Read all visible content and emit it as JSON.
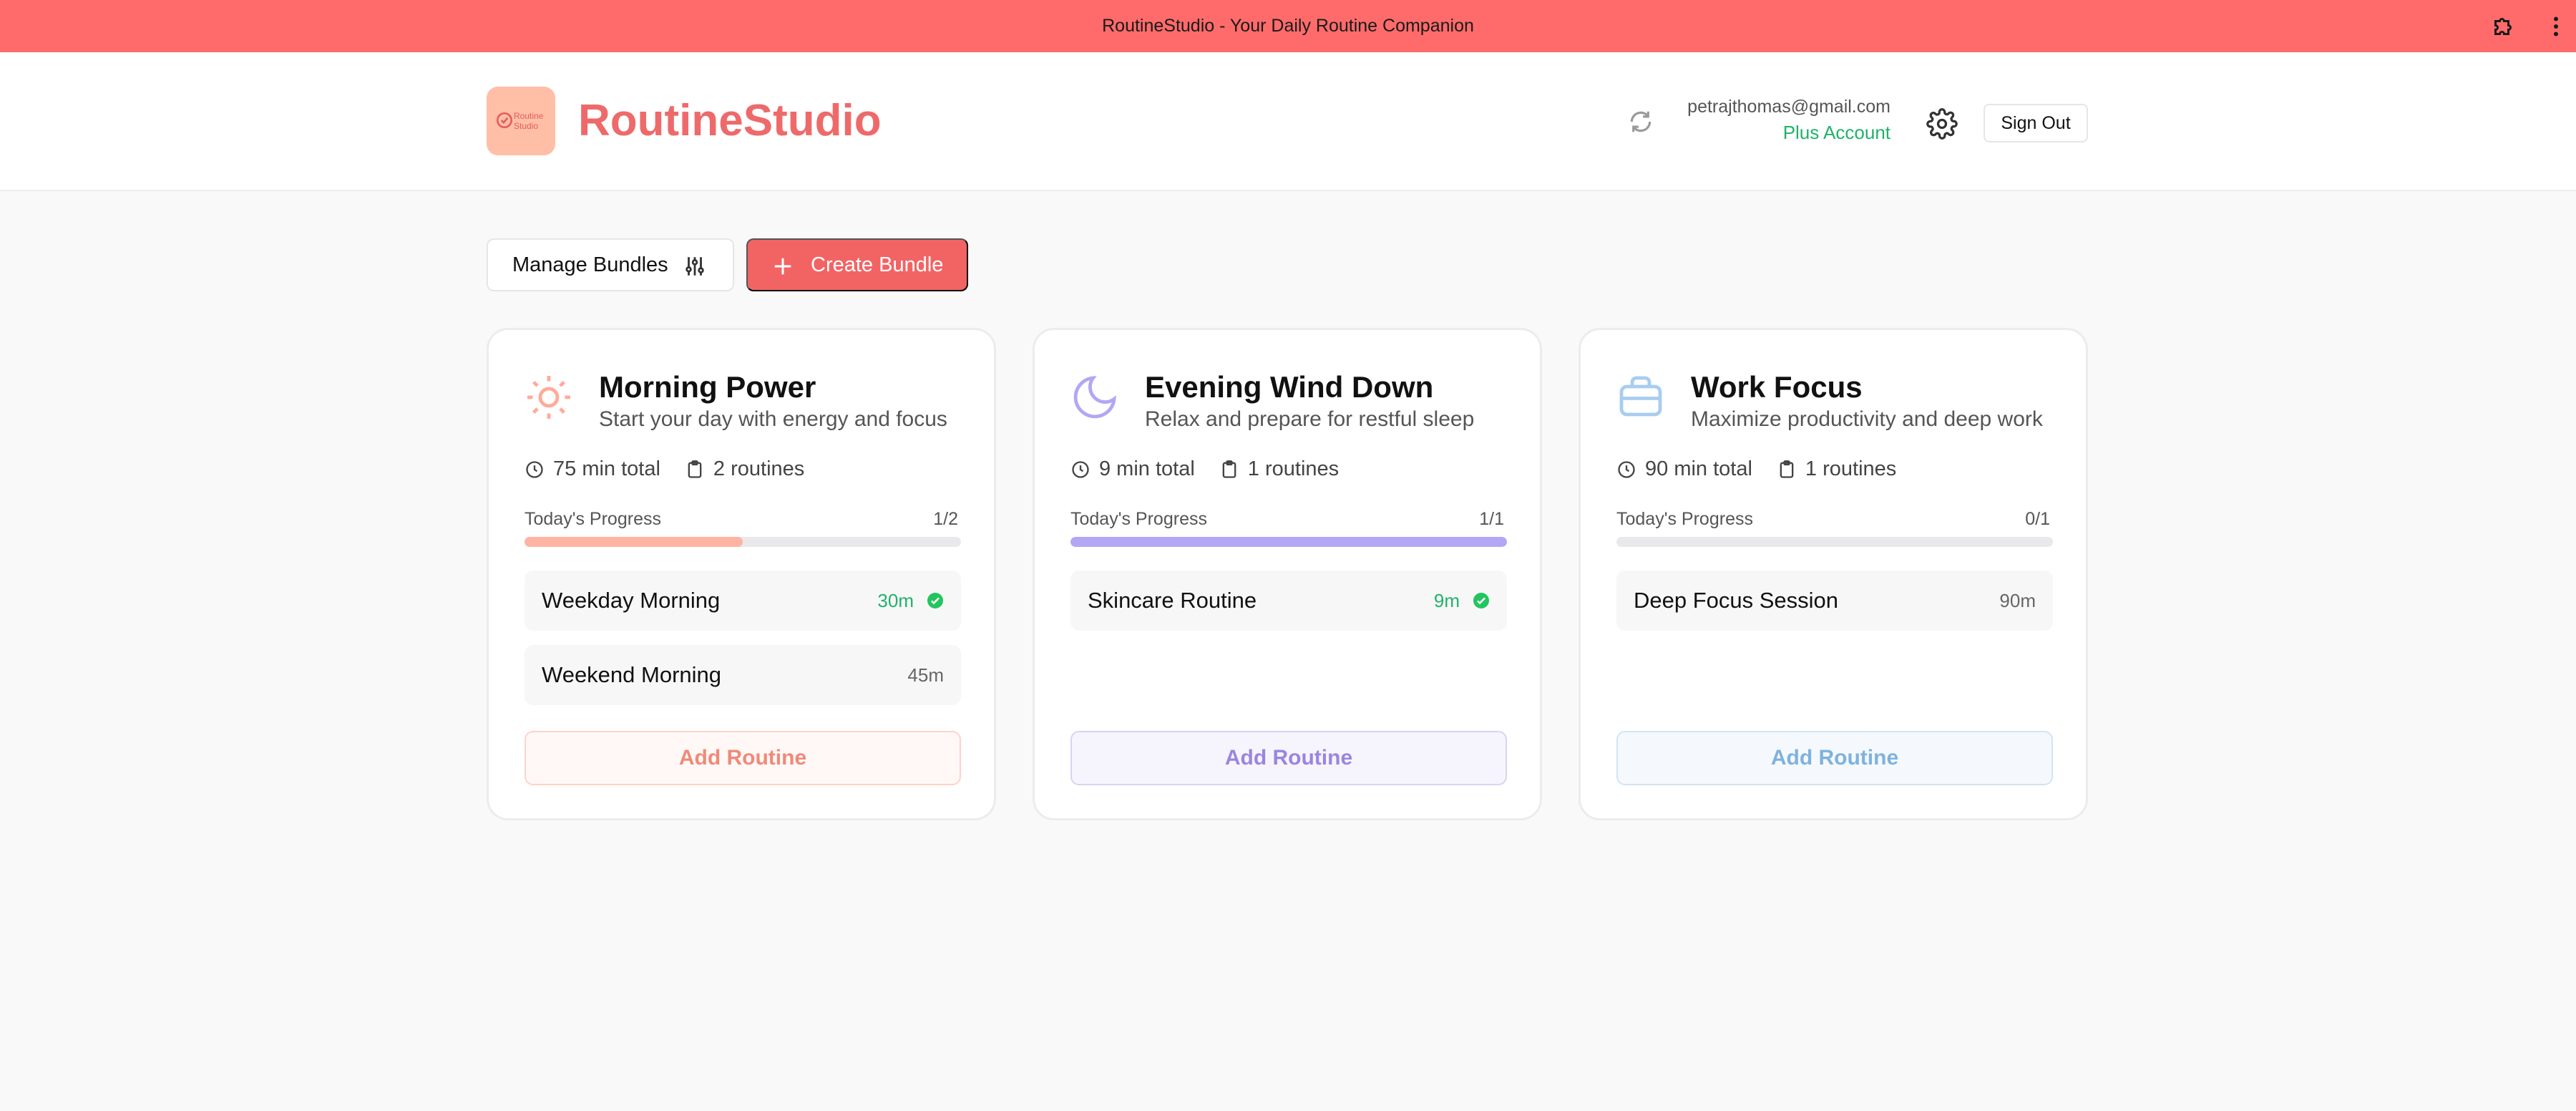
{
  "window": {
    "title": "RoutineStudio - Your Daily Routine Companion"
  },
  "brand": {
    "name": "RoutineStudio",
    "logo_text": "Routine Studio",
    "accent": "#ee6a6a"
  },
  "account": {
    "email": "petrajthomas@gmail.com",
    "plan": "Plus Account",
    "sign_out_label": "Sign Out"
  },
  "toolbar": {
    "manage_label": "Manage Bundles",
    "create_label": "Create Bundle"
  },
  "bundles": [
    {
      "title": "Morning Power",
      "subtitle": "Start your day with energy and focus",
      "total": "75 min total",
      "routines_count": "2 routines",
      "progress_label": "Today's Progress",
      "progress_count": "1/2",
      "progress_fraction": 0.5,
      "color": "#ffb3a3",
      "icon": "sun-icon",
      "routines": [
        {
          "name": "Weekday Morning",
          "duration": "30m",
          "done": true
        },
        {
          "name": "Weekend Morning",
          "duration": "45m",
          "done": false
        }
      ],
      "add_label": "Add Routine"
    },
    {
      "title": "Evening Wind Down",
      "subtitle": "Relax and prepare for restful sleep",
      "total": "9 min total",
      "routines_count": "1 routines",
      "progress_label": "Today's Progress",
      "progress_count": "1/1",
      "progress_fraction": 1.0,
      "color": "#b3a6f5",
      "icon": "moon-icon",
      "routines": [
        {
          "name": "Skincare Routine",
          "duration": "9m",
          "done": true
        }
      ],
      "add_label": "Add Routine"
    },
    {
      "title": "Work Focus",
      "subtitle": "Maximize productivity and deep work",
      "total": "90 min total",
      "routines_count": "1 routines",
      "progress_label": "Today's Progress",
      "progress_count": "0/1",
      "progress_fraction": 0.0,
      "color": "#a8cdf0",
      "icon": "briefcase-icon",
      "routines": [
        {
          "name": "Deep Focus Session",
          "duration": "90m",
          "done": false
        }
      ],
      "add_label": "Add Routine"
    }
  ]
}
